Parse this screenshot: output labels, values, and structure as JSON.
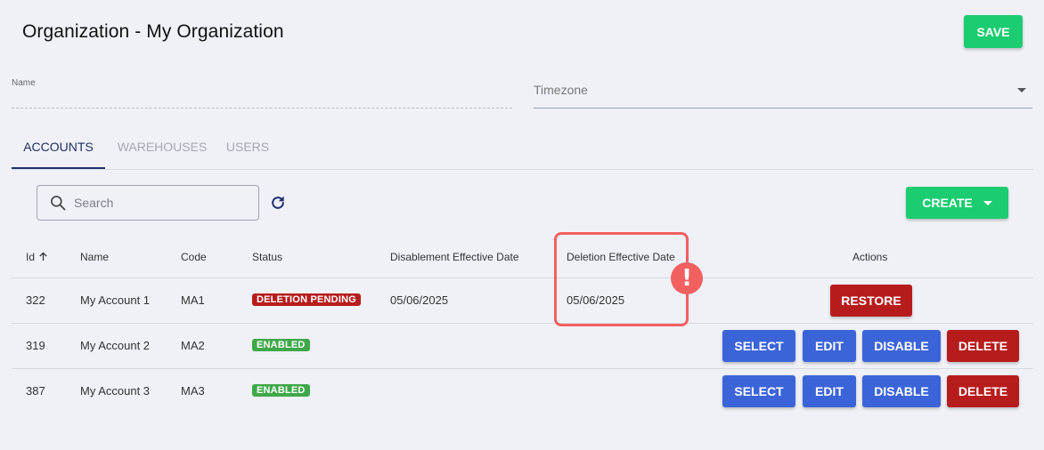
{
  "header": {
    "title": "Organization - My Organization",
    "save_label": "SAVE"
  },
  "form": {
    "name_label": "Name",
    "name_value": "",
    "timezone_label": "Timezone"
  },
  "tabs": [
    {
      "label": "ACCOUNTS",
      "active": true
    },
    {
      "label": "WAREHOUSES",
      "active": false
    },
    {
      "label": "USERS",
      "active": false
    }
  ],
  "toolbar": {
    "search_placeholder": "Search",
    "create_label": "CREATE"
  },
  "table": {
    "columns": {
      "id": "Id",
      "name": "Name",
      "code": "Code",
      "status": "Status",
      "disablement_date": "Disablement Effective Date",
      "deletion_date": "Deletion Effective Date",
      "actions": "Actions"
    },
    "rows": [
      {
        "id": "322",
        "name": "My Account 1",
        "code": "MA1",
        "status": "DELETION PENDING",
        "disablement_date": "05/06/2025",
        "deletion_date": "05/06/2025",
        "restore_label": "RESTORE"
      },
      {
        "id": "319",
        "name": "My Account 2",
        "code": "MA2",
        "status": "ENABLED",
        "disablement_date": "",
        "deletion_date": "",
        "select_label": "SELECT",
        "edit_label": "EDIT",
        "disable_label": "DISABLE",
        "delete_label": "DELETE"
      },
      {
        "id": "387",
        "name": "My Account 3",
        "code": "MA3",
        "status": "ENABLED",
        "disablement_date": "",
        "deletion_date": "",
        "select_label": "SELECT",
        "edit_label": "EDIT",
        "disable_label": "DISABLE",
        "delete_label": "DELETE"
      }
    ]
  },
  "annotation": {
    "alert_symbol": "!"
  },
  "colors": {
    "background": "#eff1f7",
    "primary_green": "#1ccc70",
    "action_blue": "#3c64d9",
    "danger_red": "#b71c1c",
    "enabled_green": "#3fa84a",
    "highlight": "#f26060",
    "tab_active": "#1f2d5c"
  },
  "icons": {
    "search": "search-icon",
    "refresh": "refresh-icon",
    "sort": "arrow-up-icon",
    "dropdown": "chevron-down-icon",
    "alert": "exclamation-icon"
  }
}
